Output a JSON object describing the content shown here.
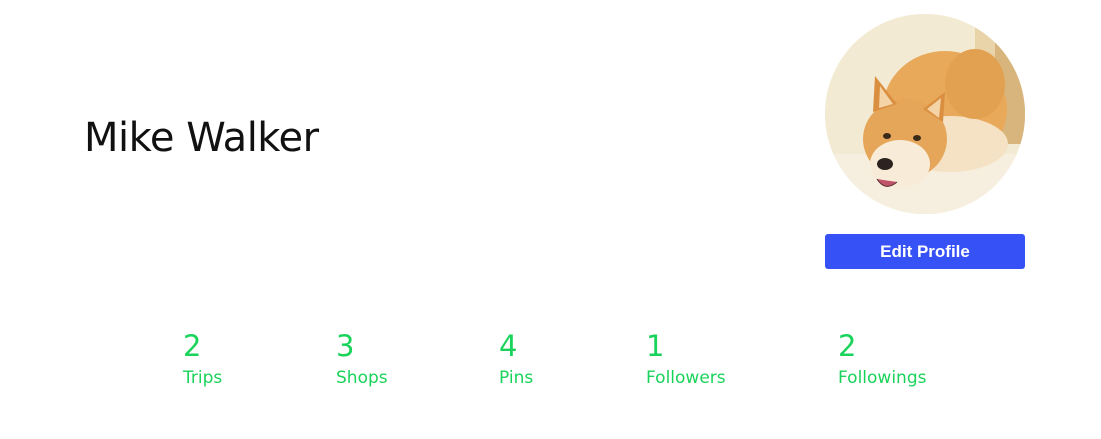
{
  "profile": {
    "name": "Mike Walker",
    "edit_label": "Edit Profile",
    "avatar_icon": "shiba-dog-photo"
  },
  "stats": [
    {
      "count": "2",
      "label": "Trips"
    },
    {
      "count": "3",
      "label": "Shops"
    },
    {
      "count": "4",
      "label": "Pins"
    },
    {
      "count": "1",
      "label": "Followers"
    },
    {
      "count": "2",
      "label": "Followings"
    }
  ],
  "colors": {
    "accent_button": "#3651f5",
    "stat_green": "#1ad35a",
    "name_text": "#111111"
  }
}
